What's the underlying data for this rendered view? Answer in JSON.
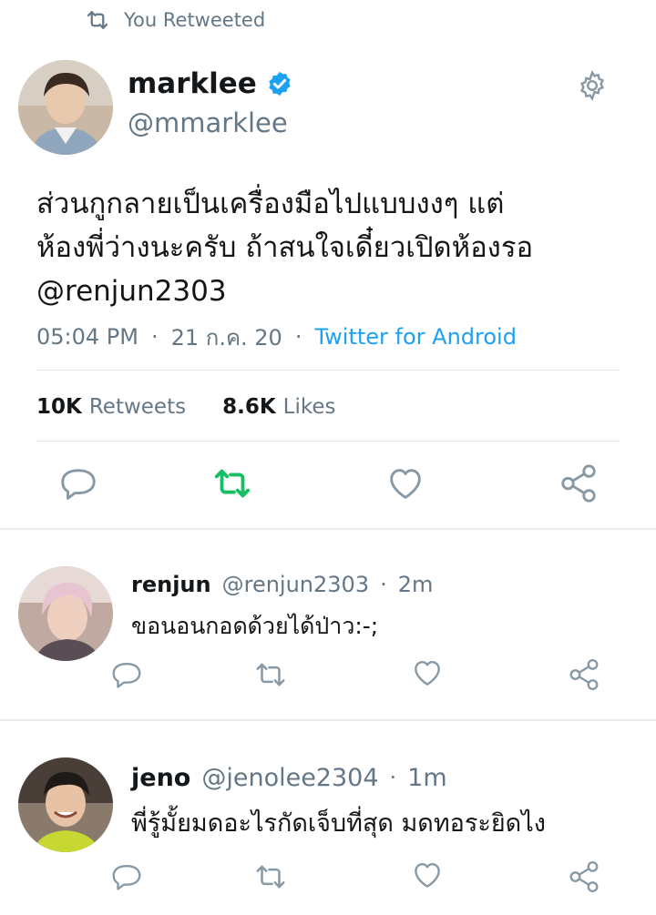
{
  "retweet_header": {
    "label": "You Retweeted"
  },
  "tweet": {
    "display_name": "marklee",
    "handle": "@mmarklee",
    "text_line1": "ส่วนกูกลายเป็นเครื่องมือไปแบบงงๆ แต่",
    "text_line2": "ห้องพี่ว่างนะครับ ถ้าสนใจเดี๋ยวเปิดห้องรอ",
    "mention": "@renjun2303",
    "time": "05:04 PM",
    "date": "21 ก.ค. 20",
    "client": "Twitter for Android",
    "retweets_count": "10K",
    "retweets_label": "Retweets",
    "likes_count": "8.6K",
    "likes_label": "Likes"
  },
  "replies": [
    {
      "name": "renjun",
      "handle": "@renjun2303",
      "age": "2m",
      "text": "ขอนอนกอดด้วยได้ป่าว:-;"
    },
    {
      "name": "jeno",
      "handle": "@jenolee2304",
      "age": "1m",
      "text": "พี่รู้มั้ยมดอะไรกัดเจ็บที่สุด มดทอระยิดไง"
    }
  ],
  "colors": {
    "accent": "#1da1f2",
    "retweet_active": "#17bf63",
    "muted": "#657786",
    "icon": "#8899a6"
  },
  "icons": [
    "retweet-icon",
    "verified-badge-icon",
    "gear-icon",
    "reply-icon",
    "heart-icon",
    "share-icon"
  ]
}
